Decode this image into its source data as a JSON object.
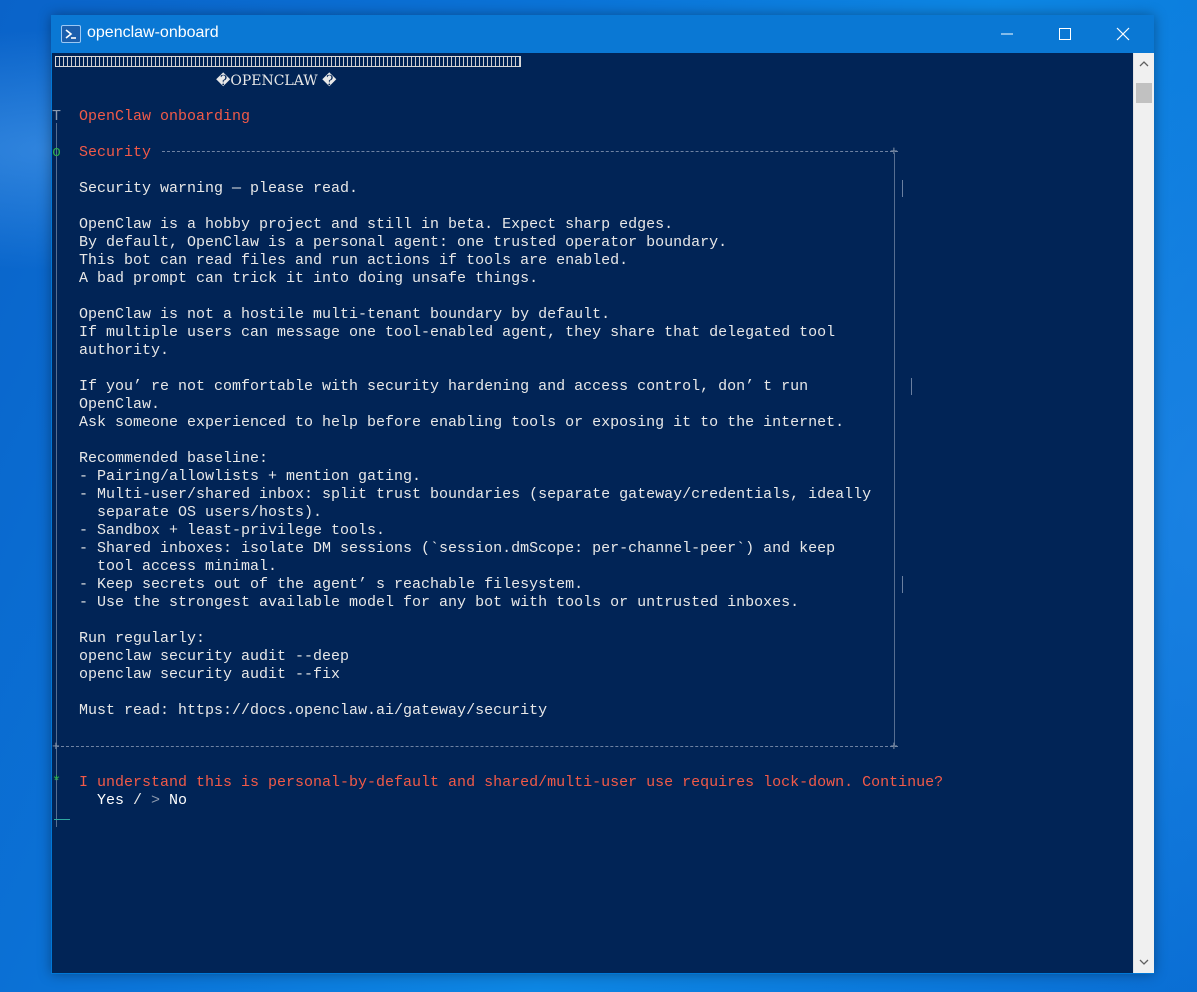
{
  "window": {
    "title": "openclaw-onboard",
    "controls": {
      "minimize": "minimize",
      "maximize": "maximize",
      "close": "close"
    }
  },
  "console": {
    "banner_title": "�OPENCLAW �",
    "onboarding_marker": "T",
    "onboarding_title": "OpenClaw onboarding",
    "security_marker": "o",
    "security_title": "Security",
    "lines": [
      "Security warning — please read.",
      "OpenClaw is a hobby project and still in beta. Expect sharp edges.",
      "By default, OpenClaw is a personal agent: one trusted operator boundary.",
      "This bot can read files and run actions if tools are enabled.",
      "A bad prompt can trick it into doing unsafe things.",
      "OpenClaw is not a hostile multi-tenant boundary by default.",
      "If multiple users can message one tool-enabled agent, they share that delegated tool",
      "authority.",
      "If you’ re not comfortable with security hardening and access control, don’ t run",
      "OpenClaw.",
      "Ask someone experienced to help before enabling tools or exposing it to the internet.",
      "Recommended baseline:",
      "- Pairing/allowlists + mention gating.",
      "- Multi-user/shared inbox: split trust boundaries (separate gateway/credentials, ideally",
      "  separate OS users/hosts).",
      "- Sandbox + least-privilege tools.",
      "- Shared inboxes: isolate DM sessions (`session.dmScope: per-channel-peer`) and keep",
      "  tool access minimal.",
      "- Keep secrets out of the agent’ s reachable filesystem.",
      "- Use the strongest available model for any bot with tools or untrusted inboxes.",
      "Run regularly:",
      "openclaw security audit --deep",
      "openclaw security audit --fix",
      "Must read: https://docs.openclaw.ai/gateway/security"
    ],
    "prompt_marker": "*",
    "prompt_question": "I understand this is personal-by-default and shared/multi-user use requires lock-down. Continue?",
    "option_yes": "Yes",
    "option_separator": "/",
    "option_cursor": ">",
    "option_no": "No"
  },
  "colors": {
    "console_bg": "#012456",
    "accent_red": "#f25a48",
    "accent_green": "#2fb34a",
    "titlebar": "#0a78d4"
  }
}
